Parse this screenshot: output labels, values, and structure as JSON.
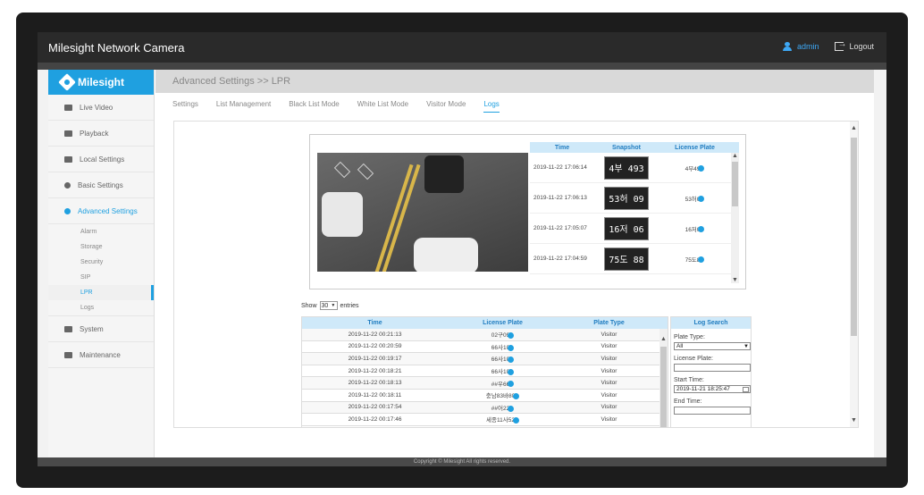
{
  "header": {
    "title": "Milesight Network Camera",
    "user": "admin",
    "logout": "Logout"
  },
  "logo": {
    "text": "Milesight"
  },
  "sidebar": {
    "items": [
      {
        "label": "Live Video"
      },
      {
        "label": "Playback"
      },
      {
        "label": "Local Settings"
      },
      {
        "label": "Basic Settings"
      },
      {
        "label": "Advanced Settings"
      }
    ],
    "sub_items": [
      {
        "label": "Alarm"
      },
      {
        "label": "Storage"
      },
      {
        "label": "Security"
      },
      {
        "label": "SIP"
      },
      {
        "label": "LPR"
      },
      {
        "label": "Logs"
      }
    ],
    "bottom_items": [
      {
        "label": "System"
      },
      {
        "label": "Maintenance"
      }
    ]
  },
  "breadcrumb": "Advanced Settings >> LPR",
  "tabs": [
    {
      "label": "Settings"
    },
    {
      "label": "List Management"
    },
    {
      "label": "Black List Mode"
    },
    {
      "label": "White List Mode"
    },
    {
      "label": "Visitor Mode"
    },
    {
      "label": "Logs"
    }
  ],
  "snapshot_table": {
    "headers": {
      "time": "Time",
      "snapshot": "Snapshot",
      "plate": "License Plate"
    },
    "rows": [
      {
        "time": "2019-11-22 17:06:14",
        "snapshot": "4부 493",
        "plate": "4부49"
      },
      {
        "time": "2019-11-22 17:06:13",
        "snapshot": "53허 09",
        "plate": "53허0"
      },
      {
        "time": "2019-11-22 17:05:07",
        "snapshot": "16저 06",
        "plate": "16저0"
      },
      {
        "time": "2019-11-22 17:04:59",
        "snapshot": "75도 88",
        "plate": "75도8"
      }
    ]
  },
  "show_entries": {
    "prefix": "Show",
    "value": "30",
    "suffix": "entries"
  },
  "log_table": {
    "headers": {
      "time": "Time",
      "plate": "License Plate",
      "type": "Plate Type"
    },
    "rows": [
      {
        "time": "2019-11-22 00:21:13",
        "plate": "02구09",
        "type": "Visitor"
      },
      {
        "time": "2019-11-22 00:20:59",
        "plate": "66사10",
        "type": "Visitor"
      },
      {
        "time": "2019-11-22 00:19:17",
        "plate": "66사10",
        "type": "Visitor"
      },
      {
        "time": "2019-11-22 00:18:21",
        "plate": "66사10",
        "type": "Visitor"
      },
      {
        "time": "2019-11-22 00:18:13",
        "plate": "##우66",
        "type": "Visitor"
      },
      {
        "time": "2019-11-22 00:18:11",
        "plate": "충남83바80",
        "type": "Visitor"
      },
      {
        "time": "2019-11-22 00:17:54",
        "plate": "##어22",
        "type": "Visitor"
      },
      {
        "time": "2019-11-22 00:17:46",
        "plate": "세종11사52",
        "type": "Visitor"
      }
    ]
  },
  "log_search": {
    "title": "Log Search",
    "plate_type_label": "Plate Type:",
    "plate_type_value": "All",
    "license_plate_label": "License Plate:",
    "license_plate_value": "",
    "start_time_label": "Start Time:",
    "start_time_value": "2019-11-21 18:25:47",
    "end_time_label": "End Time:"
  },
  "footer": "Copyright © Milesight All rights reserved."
}
